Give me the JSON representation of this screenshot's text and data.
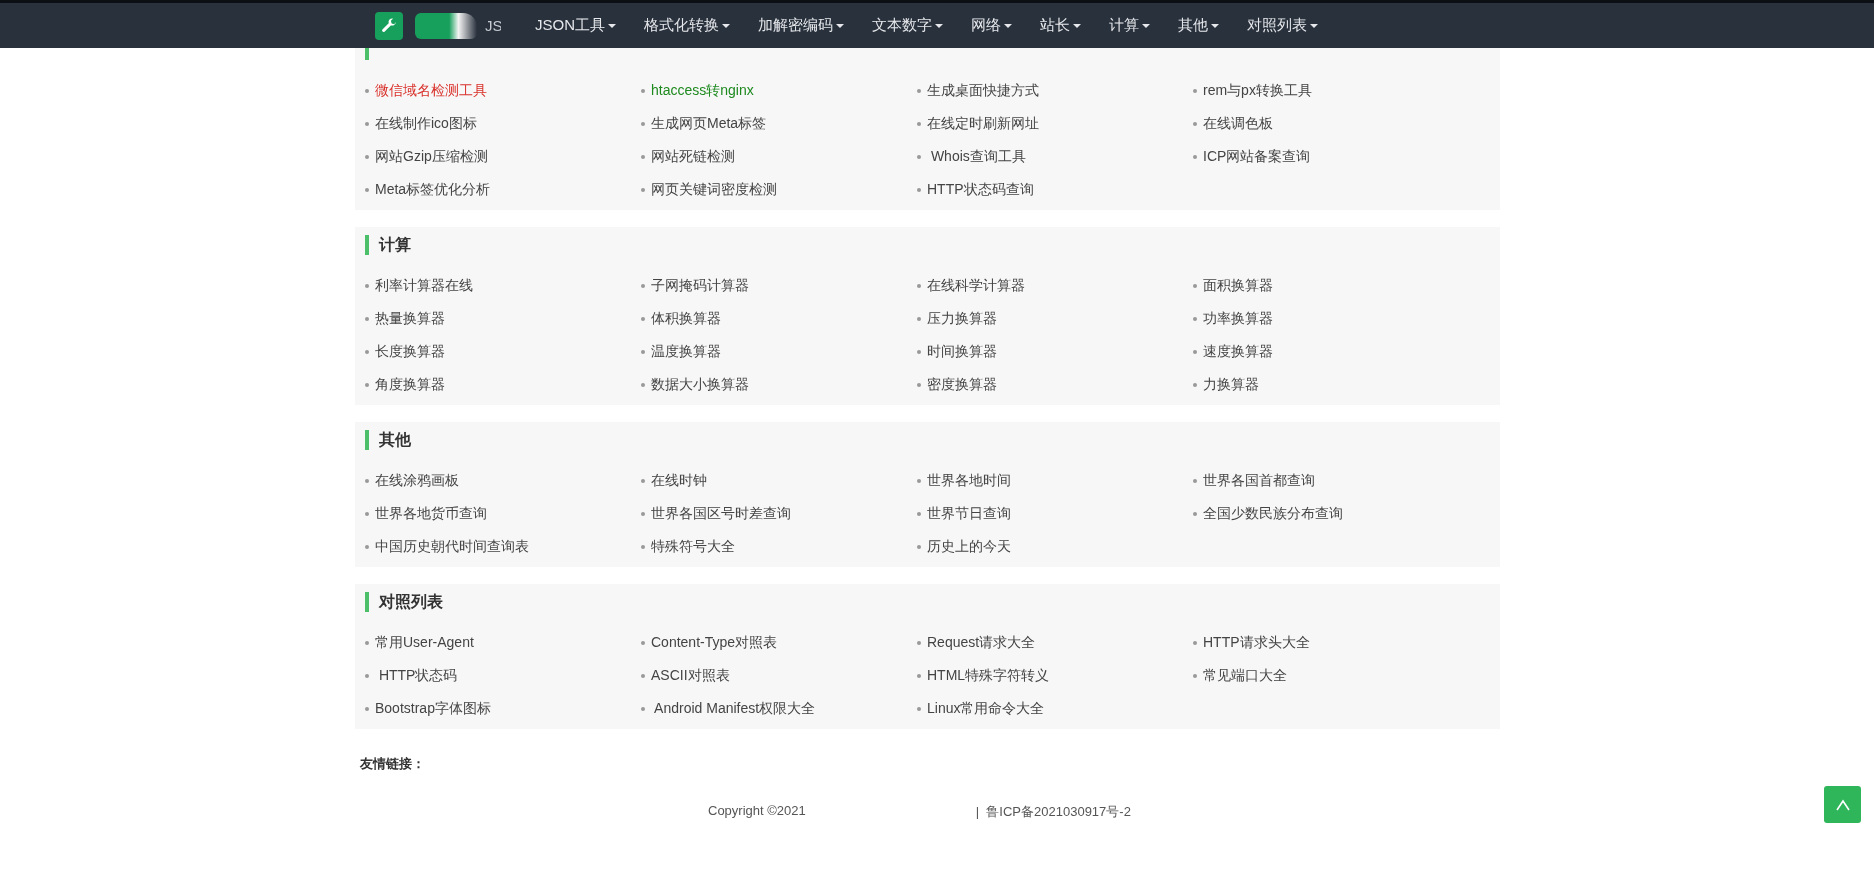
{
  "navbar": {
    "brand_text": "JS",
    "menu": [
      {
        "label": "JSON工具"
      },
      {
        "label": "格式化转换"
      },
      {
        "label": "加解密编码"
      },
      {
        "label": "文本数字"
      },
      {
        "label": "网络"
      },
      {
        "label": "站长"
      },
      {
        "label": "计算"
      },
      {
        "label": "其他"
      },
      {
        "label": "对照列表"
      }
    ]
  },
  "sections": [
    {
      "links": [
        {
          "label": "微信域名检测工具",
          "color": "#d9322b"
        },
        {
          "label": "htaccess转nginx",
          "color": "#1e8a1e"
        },
        {
          "label": "生成桌面快捷方式"
        },
        {
          "label": "rem与px转换工具"
        },
        {
          "label": "在线制作ico图标"
        },
        {
          "label": "生成网页Meta标签"
        },
        {
          "label": "在线定时刷新网址"
        },
        {
          "label": "在线调色板"
        },
        {
          "label": "网站Gzip压缩检测"
        },
        {
          "label": "网站死链检测"
        },
        {
          "label": " Whois查询工具"
        },
        {
          "label": "ICP网站备案查询"
        },
        {
          "label": "Meta标签优化分析"
        },
        {
          "label": "网页关键词密度检测"
        },
        {
          "label": "HTTP状态码查询"
        }
      ]
    },
    {
      "title": "计算",
      "links": [
        {
          "label": "利率计算器在线"
        },
        {
          "label": "子网掩码计算器"
        },
        {
          "label": "在线科学计算器"
        },
        {
          "label": "面积换算器"
        },
        {
          "label": "热量换算器"
        },
        {
          "label": "体积换算器"
        },
        {
          "label": "压力换算器"
        },
        {
          "label": "功率换算器"
        },
        {
          "label": "长度换算器"
        },
        {
          "label": "温度换算器"
        },
        {
          "label": "时间换算器"
        },
        {
          "label": "速度换算器"
        },
        {
          "label": "角度换算器"
        },
        {
          "label": "数据大小换算器"
        },
        {
          "label": "密度换算器"
        },
        {
          "label": "力换算器"
        }
      ]
    },
    {
      "title": "其他",
      "links": [
        {
          "label": "在线涂鸦画板"
        },
        {
          "label": "在线时钟"
        },
        {
          "label": "世界各地时间"
        },
        {
          "label": "世界各国首都查询"
        },
        {
          "label": "世界各地货币查询"
        },
        {
          "label": "世界各国区号时差查询"
        },
        {
          "label": "世界节日查询"
        },
        {
          "label": "全国少数民族分布查询"
        },
        {
          "label": "中国历史朝代时间查询表"
        },
        {
          "label": "特殊符号大全"
        },
        {
          "label": "历史上的今天"
        }
      ]
    },
    {
      "title": "对照列表",
      "links": [
        {
          "label": "常用User-Agent"
        },
        {
          "label": "Content-Type对照表"
        },
        {
          "label": "Request请求大全"
        },
        {
          "label": "HTTP请求头大全"
        },
        {
          "label": " HTTP状态码"
        },
        {
          "label": "ASCII对照表"
        },
        {
          "label": "HTML特殊字符转义"
        },
        {
          "label": "常见端口大全"
        },
        {
          "label": "Bootstrap字体图标"
        },
        {
          "label": " Android Manifest权限大全"
        },
        {
          "label": "Linux常用命令大全"
        }
      ]
    }
  ],
  "footer": {
    "friend_links_label": "友情链接：",
    "copyright": "Copyright ©2021",
    "icp": "|  鲁ICP备2021030917号-2"
  }
}
